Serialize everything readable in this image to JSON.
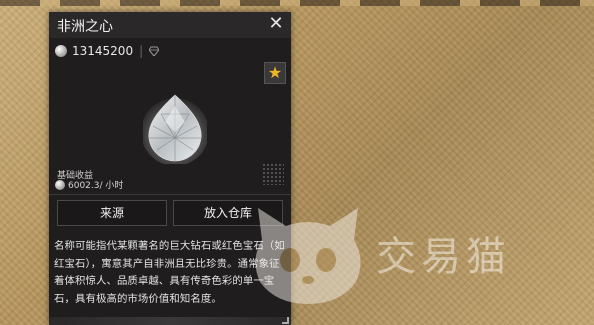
{
  "panel": {
    "title": "非洲之心",
    "close_label": "✕",
    "price": "13145200",
    "favorite_label": "★",
    "income_label": "基础收益",
    "income_value": "6002.3/ 小时",
    "buttons": {
      "source": "来源",
      "store": "放入仓库"
    },
    "description": "名称可能指代某颗著名的巨大钻石或红色宝石（如红宝石），寓意其产自非洲且无比珍贵。通常象征着体积惊人、品质卓越、具有传奇色彩的单一宝石，具有极高的市场价值和知名度。"
  },
  "watermark": {
    "text": "交易猫"
  },
  "colors": {
    "panel_bg": "#1f1d1e",
    "star": "#f0b428",
    "background": "#b8975e"
  },
  "icons": [
    "silver-coin-icon",
    "diamond-small-icon",
    "star-icon",
    "close-icon",
    "diamond-gem-icon",
    "cat-logo-icon"
  ]
}
